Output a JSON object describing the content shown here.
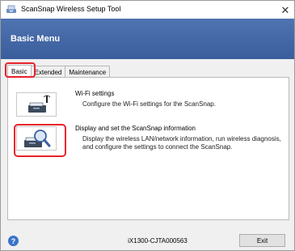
{
  "window": {
    "title": "ScanSnap Wireless Setup Tool",
    "close_glyph": "✕"
  },
  "header": {
    "title": "Basic Menu"
  },
  "tabs": [
    {
      "label": "Basic",
      "active": true
    },
    {
      "label": "Extended",
      "active": false
    },
    {
      "label": "Maintenance",
      "active": false
    }
  ],
  "items": [
    {
      "title": "Wi-Fi settings",
      "description": "Configure the Wi-Fi settings for the ScanSnap.",
      "icon": "scanner-wifi-icon"
    },
    {
      "title": "Display and set the ScanSnap information",
      "description_line1": "Display the wireless LAN/network information, run wireless diagnosis,",
      "description_line2": "and configure the settings to connect the ScanSnap.",
      "icon": "scanner-magnifier-icon"
    }
  ],
  "footer": {
    "help_glyph": "?",
    "serial": "iX1300-CJTA000563",
    "exit_label": "Exit"
  },
  "colors": {
    "header_top": "#4f74b0",
    "header_bottom": "#3a5d9c",
    "highlight": "#e8232a",
    "help_icon": "#3b73c8"
  }
}
